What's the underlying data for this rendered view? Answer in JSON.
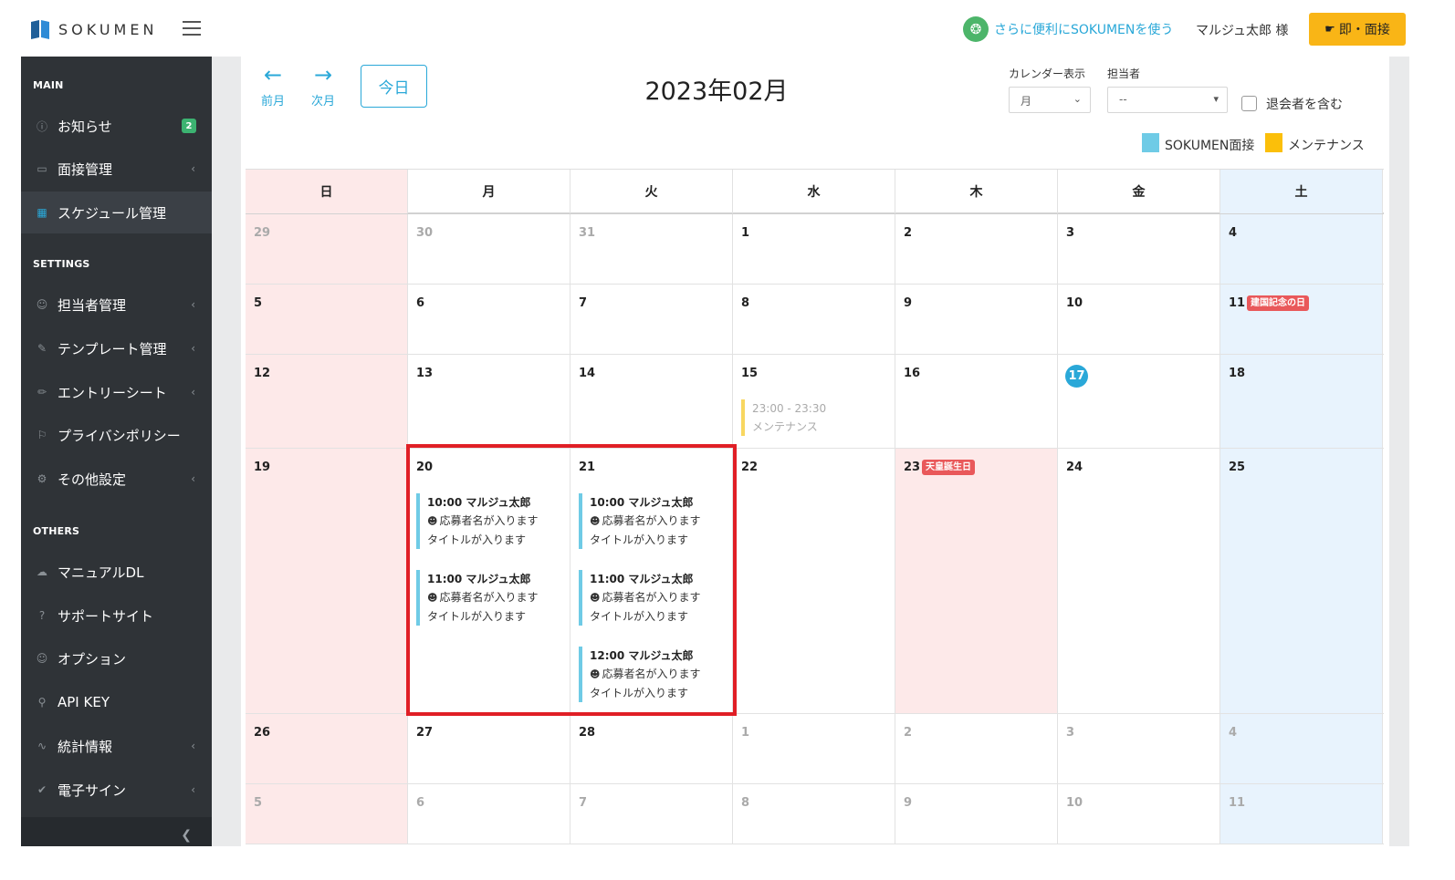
{
  "header": {
    "logo_text": "SOKUMEN",
    "promo_text": "さらに便利にSOKUMENを使う",
    "user_name": "マルジュ太郎 様",
    "interview_button": "即・面接"
  },
  "sidebar": {
    "sections": [
      {
        "label": "MAIN"
      },
      {
        "label": "SETTINGS"
      },
      {
        "label": "OTHERS"
      }
    ],
    "items": [
      {
        "label": "お知らせ",
        "icon": "info-icon",
        "badge": "2"
      },
      {
        "label": "面接管理",
        "icon": "video-icon"
      },
      {
        "label": "スケジュール管理",
        "icon": "calendar-icon",
        "active": true
      },
      {
        "label": "担当者管理",
        "icon": "user-icon"
      },
      {
        "label": "テンプレート管理",
        "icon": "edit-icon"
      },
      {
        "label": "エントリーシート",
        "icon": "pencil-icon"
      },
      {
        "label": "プライバシポリシー",
        "icon": "flag-icon"
      },
      {
        "label": "その他設定",
        "icon": "gear-icon"
      },
      {
        "label": "マニュアルDL",
        "icon": "cloud-download-icon"
      },
      {
        "label": "サポートサイト",
        "icon": "help-icon"
      },
      {
        "label": "オプション",
        "icon": "user-icon"
      },
      {
        "label": "API KEY",
        "icon": "key-icon"
      },
      {
        "label": "統計情報",
        "icon": "chart-icon"
      },
      {
        "label": "電子サイン",
        "icon": "check-circle-icon"
      }
    ]
  },
  "toolbar": {
    "prev_label": "前月",
    "next_label": "次月",
    "today_label": "今日",
    "month_title": "2023年02月",
    "view_label": "カレンダー表示",
    "view_value": "月",
    "staff_label": "担当者",
    "staff_value": "--",
    "include_retired_label": "退会者を含む"
  },
  "legend": [
    {
      "label": "SOKUMEN面接",
      "color": "#6fcbe6"
    },
    {
      "label": "メンテナンス",
      "color": "#fbbf0a"
    }
  ],
  "calendar": {
    "weekdays": [
      "日",
      "月",
      "火",
      "水",
      "木",
      "金",
      "土"
    ],
    "weeks": [
      [
        {
          "d": "29",
          "o": true
        },
        {
          "d": "30",
          "o": true
        },
        {
          "d": "31",
          "o": true
        },
        {
          "d": "1"
        },
        {
          "d": "2"
        },
        {
          "d": "3"
        },
        {
          "d": "4"
        }
      ],
      [
        {
          "d": "5"
        },
        {
          "d": "6"
        },
        {
          "d": "7"
        },
        {
          "d": "8"
        },
        {
          "d": "9"
        },
        {
          "d": "10"
        },
        {
          "d": "11",
          "holiday": "建国記念の日"
        }
      ],
      [
        {
          "d": "12"
        },
        {
          "d": "13"
        },
        {
          "d": "14"
        },
        {
          "d": "15",
          "events": [
            {
              "time": "23:00 - 23:30",
              "name": "メンテナンス",
              "kind": "maint"
            }
          ]
        },
        {
          "d": "16"
        },
        {
          "d": "17",
          "today": true
        },
        {
          "d": "18"
        }
      ],
      [
        {
          "d": "19"
        },
        {
          "d": "20",
          "events": [
            {
              "time": "10:00",
              "name": "マルジュ太郎",
              "applicant": "応募者名が入ります",
              "title": "タイトルが入ります"
            },
            {
              "time": "11:00",
              "name": "マルジュ太郎",
              "applicant": "応募者名が入ります",
              "title": "タイトルが入ります"
            }
          ]
        },
        {
          "d": "21",
          "events": [
            {
              "time": "10:00",
              "name": "マルジュ太郎",
              "applicant": "応募者名が入ります",
              "title": "タイトルが入ります"
            },
            {
              "time": "11:00",
              "name": "マルジュ太郎",
              "applicant": "応募者名が入ります",
              "title": "タイトルが入ります"
            },
            {
              "time": "12:00",
              "name": "マルジュ太郎",
              "applicant": "応募者名が入ります",
              "title": "タイトルが入ります"
            }
          ]
        },
        {
          "d": "22"
        },
        {
          "d": "23",
          "holiday": "天皇誕生日"
        },
        {
          "d": "24"
        },
        {
          "d": "25"
        }
      ],
      [
        {
          "d": "26"
        },
        {
          "d": "27"
        },
        {
          "d": "28"
        },
        {
          "d": "1",
          "o": true
        },
        {
          "d": "2",
          "o": true
        },
        {
          "d": "3",
          "o": true
        },
        {
          "d": "4",
          "o": true
        }
      ],
      [
        {
          "d": "5",
          "o": true
        },
        {
          "d": "6",
          "o": true
        },
        {
          "d": "7",
          "o": true
        },
        {
          "d": "8",
          "o": true
        },
        {
          "d": "9",
          "o": true
        },
        {
          "d": "10",
          "o": true
        },
        {
          "d": "11",
          "o": true
        }
      ]
    ]
  }
}
